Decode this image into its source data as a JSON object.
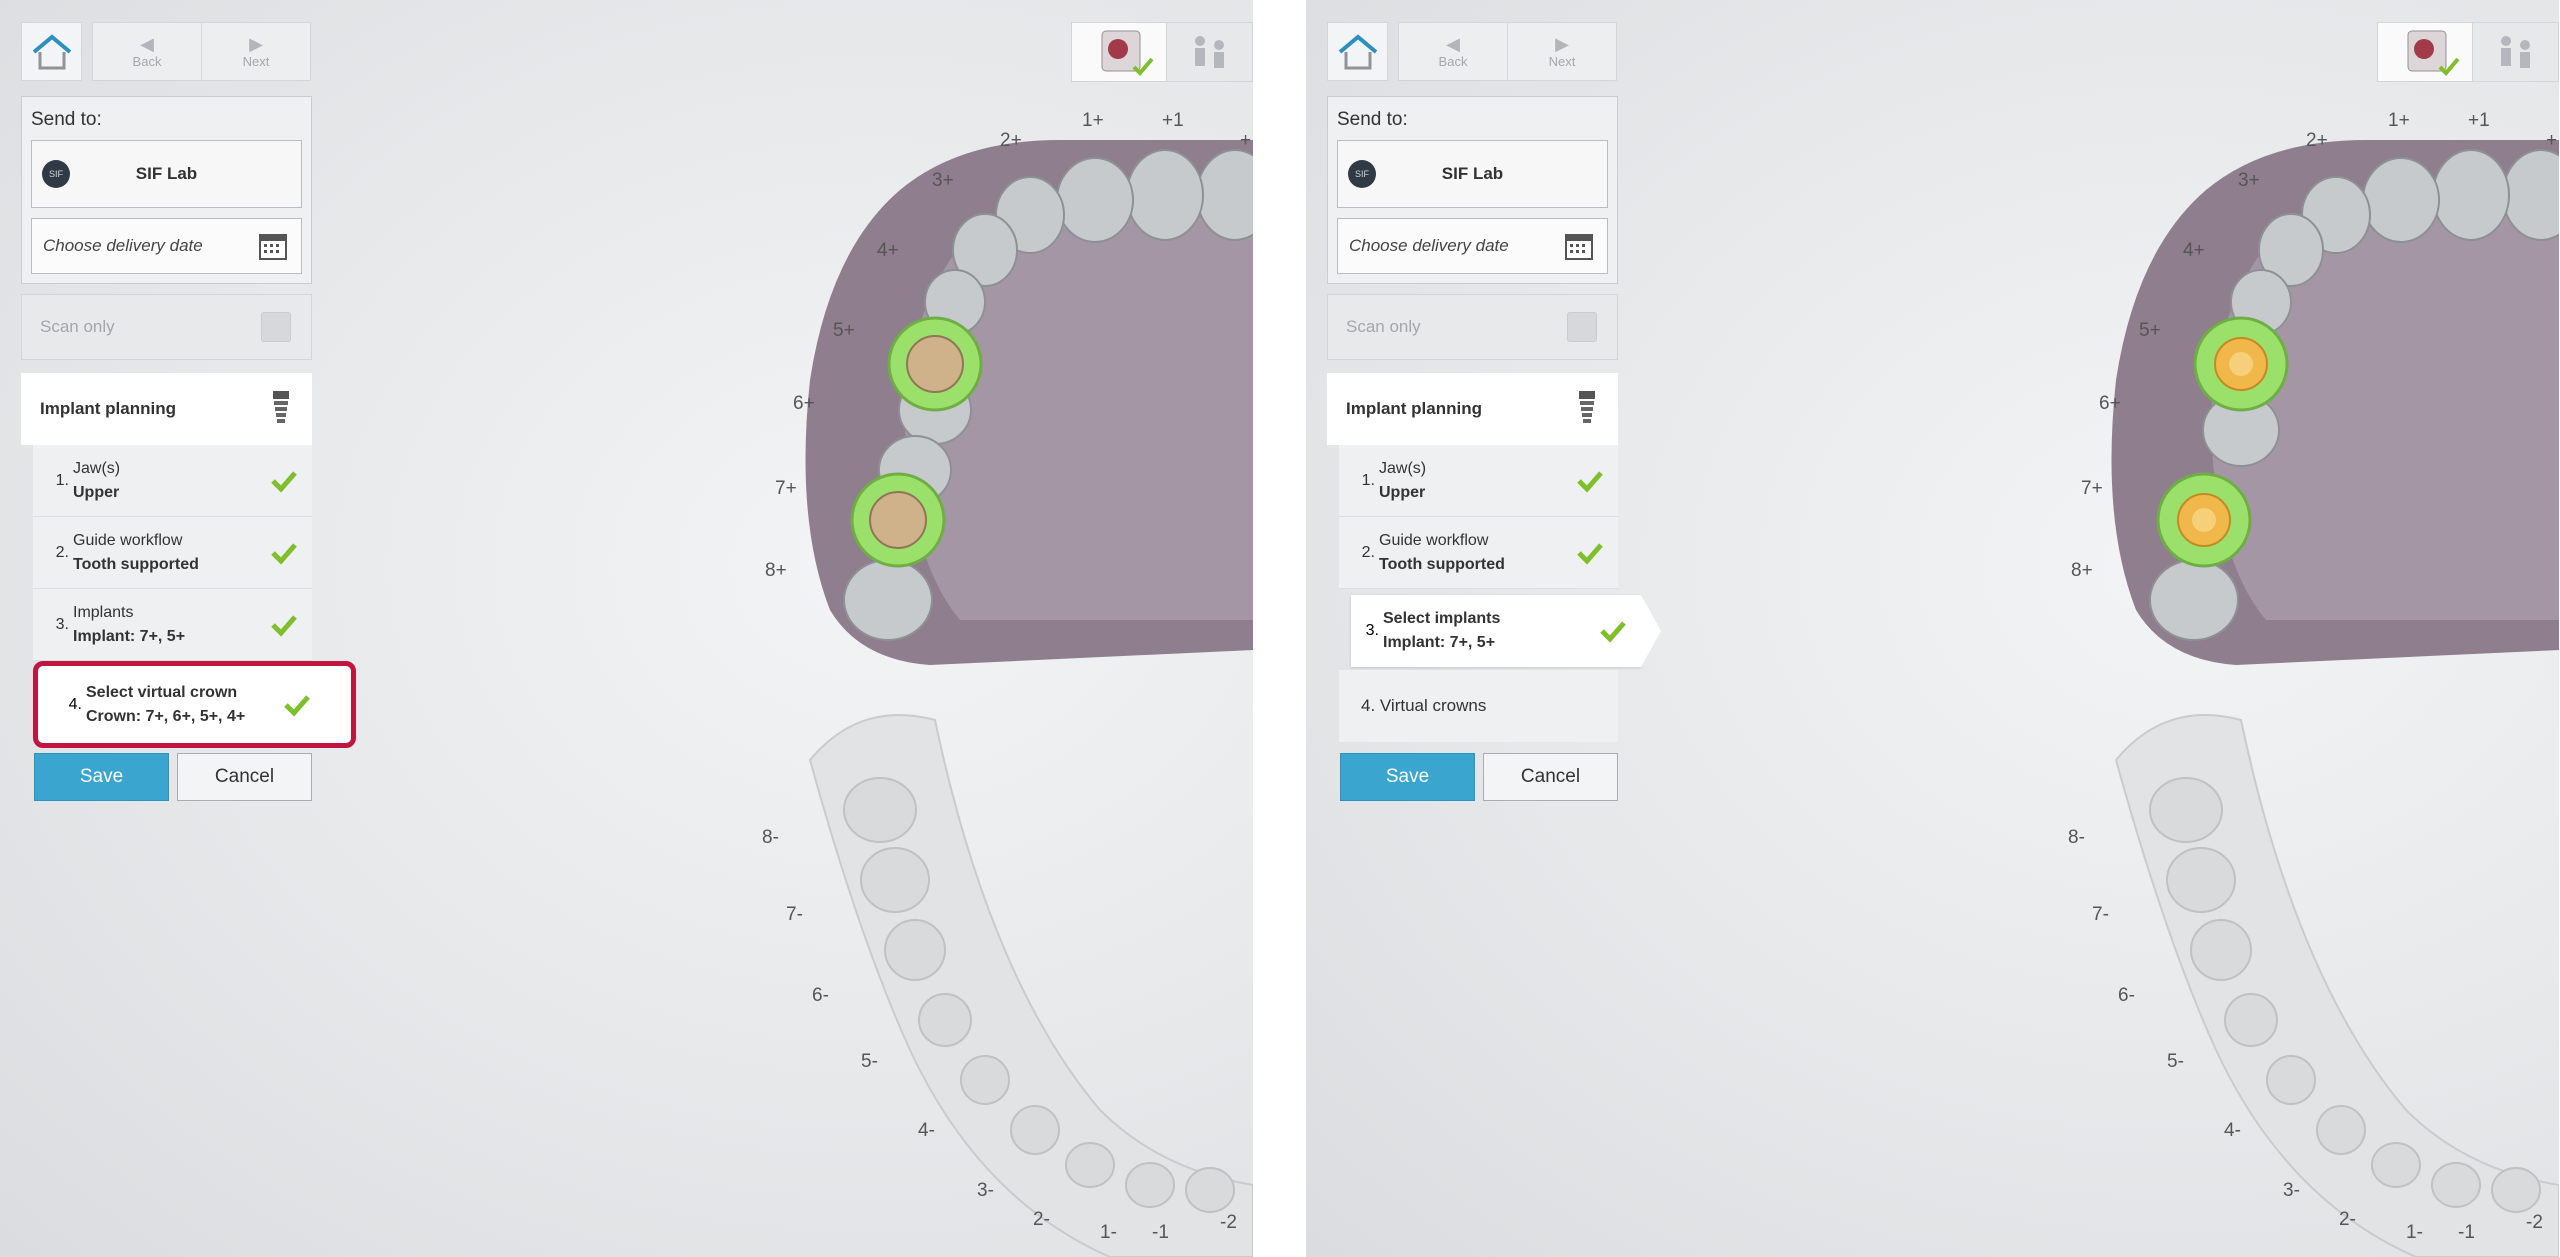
{
  "colors": {
    "accent": "#3aa5cf",
    "check": "#7fbf2a",
    "highlight": "#c0153f",
    "implant_ring": "#9be06a",
    "gingiva": "#8f7e8e",
    "tooth_gray": "#c9cccf"
  },
  "left": {
    "nav": {
      "back_label": "Back",
      "next_label": "Next"
    },
    "send_to_label": "Send to:",
    "lab_logo_text": "SIF",
    "lab_name": "SIF Lab",
    "delivery_placeholder": "Choose delivery date",
    "scan_only_label": "Scan only",
    "implant_planning_label": "Implant planning",
    "steps": [
      {
        "num": "1.",
        "title": "Jaw(s)",
        "value": "Upper"
      },
      {
        "num": "2.",
        "title": "Guide workflow",
        "value": "Tooth supported"
      },
      {
        "num": "3.",
        "title": "Implants",
        "value": "Implant: 7+, 5+"
      }
    ],
    "active_step": {
      "num": "4.",
      "title": "Select virtual crown",
      "value": "Crown: 7+, 6+, 5+, 4+"
    },
    "save_label": "Save",
    "cancel_label": "Cancel",
    "upper_teeth": [
      "2+",
      "1+",
      "+1",
      "+",
      "3+",
      "4+",
      "5+",
      "6+",
      "7+",
      "8+"
    ],
    "lower_teeth": [
      "8-",
      "7-",
      "6-",
      "5-",
      "4-",
      "3-",
      "2-",
      "1-",
      "-1",
      "-2"
    ]
  },
  "right": {
    "nav": {
      "back_label": "Back",
      "next_label": "Next"
    },
    "send_to_label": "Send to:",
    "lab_logo_text": "SIF",
    "lab_name": "SIF Lab",
    "delivery_placeholder": "Choose delivery date",
    "scan_only_label": "Scan only",
    "implant_planning_label": "Implant planning",
    "steps": [
      {
        "num": "1.",
        "title": "Jaw(s)",
        "value": "Upper"
      },
      {
        "num": "2.",
        "title": "Guide workflow",
        "value": "Tooth supported"
      }
    ],
    "active_step": {
      "num": "3.",
      "title": "Select implants",
      "value": "Implant: 7+, 5+"
    },
    "next_step": {
      "label": "4. Virtual crowns"
    },
    "save_label": "Save",
    "cancel_label": "Cancel",
    "upper_teeth": [
      "2+",
      "1+",
      "+1",
      "+",
      "3+",
      "4+",
      "5+",
      "6+",
      "7+",
      "8+"
    ],
    "lower_teeth": [
      "8-",
      "7-",
      "6-",
      "5-",
      "4-",
      "3-",
      "2-",
      "1-",
      "-1",
      "-2"
    ]
  }
}
